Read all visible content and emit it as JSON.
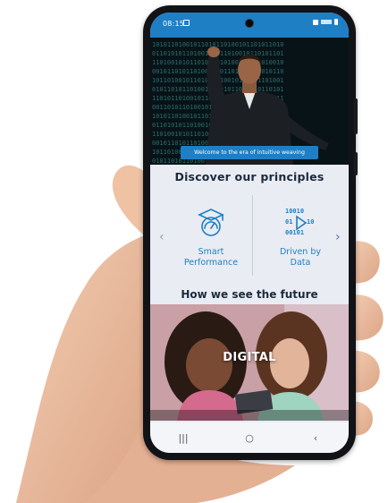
{
  "status_bar": {
    "time": "08:15"
  },
  "hero": {
    "banner_text": "Welcome to the era of intuitive weaving"
  },
  "principles": {
    "heading": "Discover our principles",
    "items": [
      {
        "label_line1": "Smart",
        "label_line2": "Performance",
        "icon": "graduation-gauge-icon"
      },
      {
        "label_line1": "Driven by",
        "label_line2": "Data",
        "icon": "binary-data-icon"
      }
    ]
  },
  "future": {
    "heading": "How we see the future",
    "video_caption": "DIGITAL"
  },
  "nav_bar": {
    "recents": "|||",
    "home": "○",
    "back": "‹"
  },
  "colors": {
    "accent": "#1f7fc4",
    "heading": "#1b2a3d",
    "background": "#e9ecf3"
  }
}
